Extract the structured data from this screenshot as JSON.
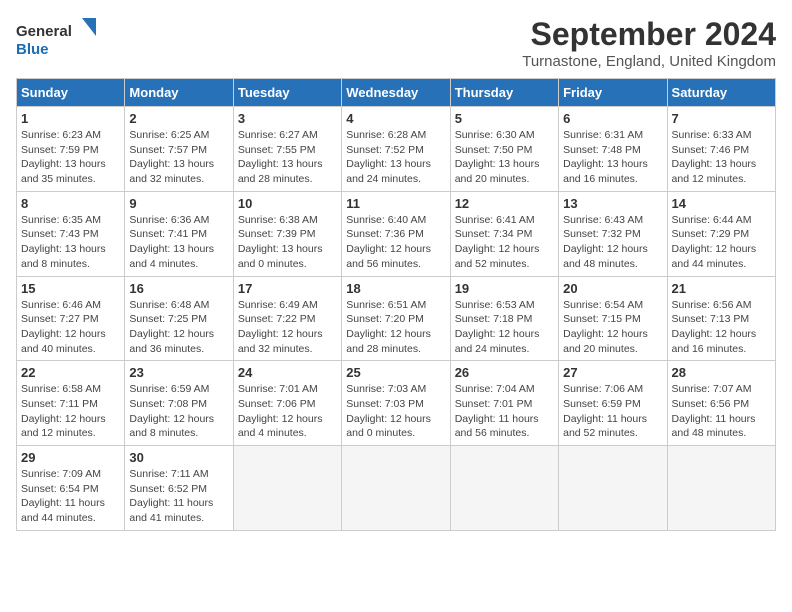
{
  "logo": {
    "line1": "General",
    "line2": "Blue"
  },
  "title": "September 2024",
  "subtitle": "Turnastone, England, United Kingdom",
  "days": [
    "Sunday",
    "Monday",
    "Tuesday",
    "Wednesday",
    "Thursday",
    "Friday",
    "Saturday"
  ],
  "weeks": [
    [
      {
        "day": "1",
        "sunrise": "6:23 AM",
        "sunset": "7:59 PM",
        "daylight": "13 hours and 35 minutes."
      },
      {
        "day": "2",
        "sunrise": "6:25 AM",
        "sunset": "7:57 PM",
        "daylight": "13 hours and 32 minutes."
      },
      {
        "day": "3",
        "sunrise": "6:27 AM",
        "sunset": "7:55 PM",
        "daylight": "13 hours and 28 minutes."
      },
      {
        "day": "4",
        "sunrise": "6:28 AM",
        "sunset": "7:52 PM",
        "daylight": "13 hours and 24 minutes."
      },
      {
        "day": "5",
        "sunrise": "6:30 AM",
        "sunset": "7:50 PM",
        "daylight": "13 hours and 20 minutes."
      },
      {
        "day": "6",
        "sunrise": "6:31 AM",
        "sunset": "7:48 PM",
        "daylight": "13 hours and 16 minutes."
      },
      {
        "day": "7",
        "sunrise": "6:33 AM",
        "sunset": "7:46 PM",
        "daylight": "13 hours and 12 minutes."
      }
    ],
    [
      {
        "day": "8",
        "sunrise": "6:35 AM",
        "sunset": "7:43 PM",
        "daylight": "13 hours and 8 minutes."
      },
      {
        "day": "9",
        "sunrise": "6:36 AM",
        "sunset": "7:41 PM",
        "daylight": "13 hours and 4 minutes."
      },
      {
        "day": "10",
        "sunrise": "6:38 AM",
        "sunset": "7:39 PM",
        "daylight": "13 hours and 0 minutes."
      },
      {
        "day": "11",
        "sunrise": "6:40 AM",
        "sunset": "7:36 PM",
        "daylight": "12 hours and 56 minutes."
      },
      {
        "day": "12",
        "sunrise": "6:41 AM",
        "sunset": "7:34 PM",
        "daylight": "12 hours and 52 minutes."
      },
      {
        "day": "13",
        "sunrise": "6:43 AM",
        "sunset": "7:32 PM",
        "daylight": "12 hours and 48 minutes."
      },
      {
        "day": "14",
        "sunrise": "6:44 AM",
        "sunset": "7:29 PM",
        "daylight": "12 hours and 44 minutes."
      }
    ],
    [
      {
        "day": "15",
        "sunrise": "6:46 AM",
        "sunset": "7:27 PM",
        "daylight": "12 hours and 40 minutes."
      },
      {
        "day": "16",
        "sunrise": "6:48 AM",
        "sunset": "7:25 PM",
        "daylight": "12 hours and 36 minutes."
      },
      {
        "day": "17",
        "sunrise": "6:49 AM",
        "sunset": "7:22 PM",
        "daylight": "12 hours and 32 minutes."
      },
      {
        "day": "18",
        "sunrise": "6:51 AM",
        "sunset": "7:20 PM",
        "daylight": "12 hours and 28 minutes."
      },
      {
        "day": "19",
        "sunrise": "6:53 AM",
        "sunset": "7:18 PM",
        "daylight": "12 hours and 24 minutes."
      },
      {
        "day": "20",
        "sunrise": "6:54 AM",
        "sunset": "7:15 PM",
        "daylight": "12 hours and 20 minutes."
      },
      {
        "day": "21",
        "sunrise": "6:56 AM",
        "sunset": "7:13 PM",
        "daylight": "12 hours and 16 minutes."
      }
    ],
    [
      {
        "day": "22",
        "sunrise": "6:58 AM",
        "sunset": "7:11 PM",
        "daylight": "12 hours and 12 minutes."
      },
      {
        "day": "23",
        "sunrise": "6:59 AM",
        "sunset": "7:08 PM",
        "daylight": "12 hours and 8 minutes."
      },
      {
        "day": "24",
        "sunrise": "7:01 AM",
        "sunset": "7:06 PM",
        "daylight": "12 hours and 4 minutes."
      },
      {
        "day": "25",
        "sunrise": "7:03 AM",
        "sunset": "7:03 PM",
        "daylight": "12 hours and 0 minutes."
      },
      {
        "day": "26",
        "sunrise": "7:04 AM",
        "sunset": "7:01 PM",
        "daylight": "11 hours and 56 minutes."
      },
      {
        "day": "27",
        "sunrise": "7:06 AM",
        "sunset": "6:59 PM",
        "daylight": "11 hours and 52 minutes."
      },
      {
        "day": "28",
        "sunrise": "7:07 AM",
        "sunset": "6:56 PM",
        "daylight": "11 hours and 48 minutes."
      }
    ],
    [
      {
        "day": "29",
        "sunrise": "7:09 AM",
        "sunset": "6:54 PM",
        "daylight": "11 hours and 44 minutes."
      },
      {
        "day": "30",
        "sunrise": "7:11 AM",
        "sunset": "6:52 PM",
        "daylight": "11 hours and 41 minutes."
      },
      null,
      null,
      null,
      null,
      null
    ]
  ]
}
